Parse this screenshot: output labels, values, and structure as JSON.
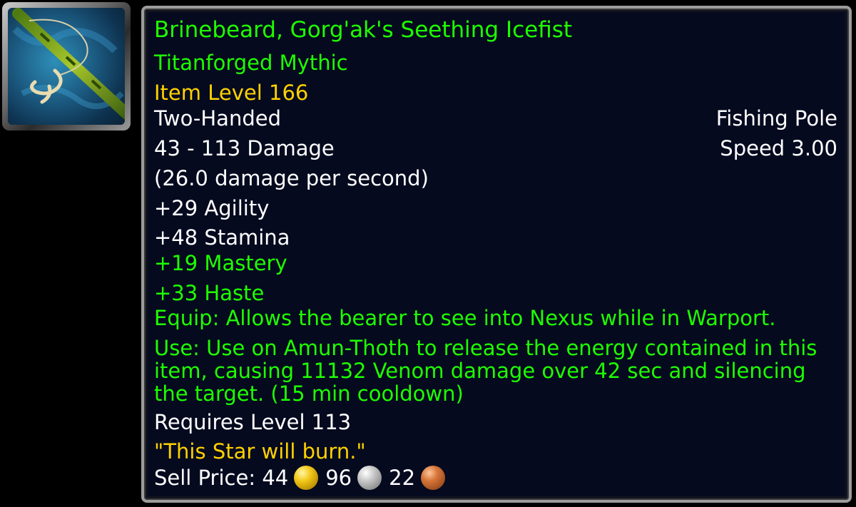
{
  "item": {
    "name": "Brinebeard, Gorg'ak's Seething Icefist",
    "quality": "Titanforged Mythic",
    "item_level": "Item Level 166",
    "slot": "Two-Handed",
    "type": "Fishing Pole",
    "damage": "43 - 113 Damage",
    "speed": "Speed 3.00",
    "dps": "(26.0 damage per second)",
    "stats": {
      "agility": "+29 Agility",
      "stamina": "+48 Stamina",
      "mastery": "+19 Mastery",
      "haste": "+33 Haste"
    },
    "equip": "Equip: Allows the bearer to see into Nexus while in Warport.",
    "use": "Use: Use on Amun-Thoth to release the energy contained in this item, causing 11132 Venom damage over 42 sec and silencing the target. (15 min cooldown)",
    "requires": "Requires Level 113",
    "flavor": "\"This Star will burn.\"",
    "sell_price": {
      "label": "Sell Price:",
      "gold": "44",
      "silver": "96",
      "copper": "22"
    },
    "icon": "fishing-pole-icon"
  },
  "colors": {
    "name_green": "#1eff00",
    "item_level_yellow": "#ffd100",
    "flavor_yellow": "#ffd100",
    "text_white": "#ffffff",
    "tooltip_bg": "#050a1f",
    "border_gray": "#9c9c9c"
  }
}
